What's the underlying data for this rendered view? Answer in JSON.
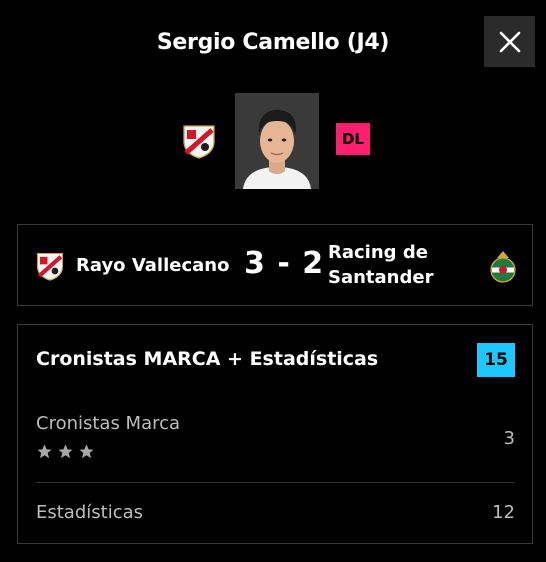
{
  "header": {
    "title": "Sergio Camello (J4)"
  },
  "player": {
    "position": "DL"
  },
  "match": {
    "home_team": "Rayo Vallecano",
    "score": "3 - 2",
    "away_team_line1": "Racing de",
    "away_team_line2": "Santander"
  },
  "scoring": {
    "title": "Cronistas MARCA + Estadísticas",
    "total": "15",
    "rows": [
      {
        "label": "Cronistas Marca",
        "value": "3",
        "stars": 3
      },
      {
        "label": "Estadísticas",
        "value": "12"
      }
    ]
  },
  "colors": {
    "position_badge": "#ff1f6e",
    "total_badge": "#1ec8ff",
    "background": "#000000"
  },
  "icons": {
    "close": "close-icon",
    "star": "star-icon"
  }
}
